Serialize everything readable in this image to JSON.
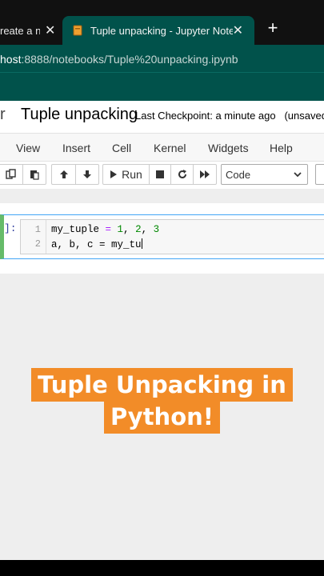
{
  "browser": {
    "tabs": [
      {
        "label": "reate a n",
        "active": false
      },
      {
        "label": "Tuple unpacking - Jupyter Noteb",
        "active": true
      }
    ],
    "url_host": "host",
    "url_rest": ":8888/notebooks/Tuple%20unpacking.ipynb"
  },
  "header": {
    "logo_fragment": "r",
    "notebook_name": "Tuple unpacking",
    "checkpoint": "Last Checkpoint: a minute ago",
    "unsaved": "(unsaved"
  },
  "menu": [
    "View",
    "Insert",
    "Cell",
    "Kernel",
    "Widgets",
    "Help"
  ],
  "toolbar": {
    "run_label": "Run",
    "cell_type": "Code"
  },
  "cell": {
    "prompt": "]:",
    "line_numbers": [
      "1",
      "2"
    ],
    "line1": {
      "name": "my_tuple",
      "eq": " = ",
      "v1": "1",
      "sep1": ", ",
      "v2": "2",
      "sep2": ", ",
      "v3": "3"
    },
    "line2": {
      "text": "a, b, c = my_tu"
    }
  },
  "caption": {
    "line1": "Tuple Unpacking in",
    "line2": "Python!"
  },
  "colors": {
    "teal": "#01524b",
    "caption_bg": "#f28c28",
    "cell_selected": "#66bb6a"
  }
}
